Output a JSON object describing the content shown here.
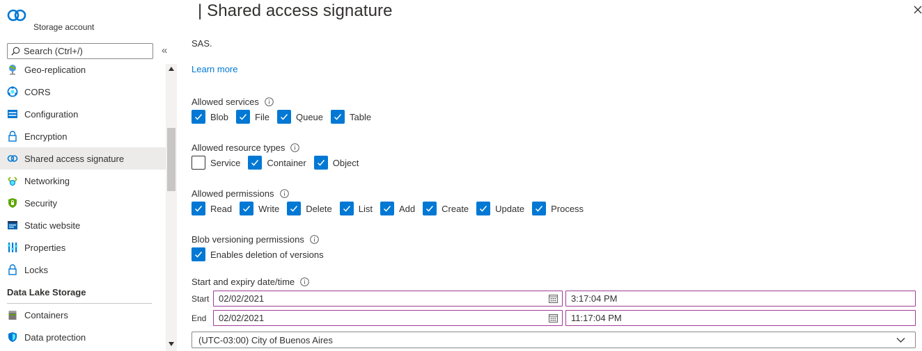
{
  "sidebar": {
    "subtitle": "Storage account",
    "search_placeholder": "Search (Ctrl+/)",
    "collapse_glyph": "«",
    "items": [
      {
        "label": "Geo-replication",
        "icon": "globe-icon"
      },
      {
        "label": "CORS",
        "icon": "cors-icon"
      },
      {
        "label": "Configuration",
        "icon": "configuration-icon"
      },
      {
        "label": "Encryption",
        "icon": "lock-icon"
      },
      {
        "label": "Shared access signature",
        "icon": "link-icon",
        "active": true
      },
      {
        "label": "Networking",
        "icon": "networking-icon"
      },
      {
        "label": "Security",
        "icon": "shield-icon"
      },
      {
        "label": "Static website",
        "icon": "static-website-icon"
      },
      {
        "label": "Properties",
        "icon": "properties-icon"
      },
      {
        "label": "Locks",
        "icon": "lock-icon"
      }
    ],
    "section_title": "Data Lake Storage",
    "section_items": [
      {
        "label": "Containers",
        "icon": "container-icon"
      },
      {
        "label": "Data protection",
        "icon": "data-protection-icon"
      }
    ]
  },
  "main": {
    "title": "| Shared access signature",
    "description": "SAS.",
    "learn_more": "Learn more",
    "allowed_services": {
      "label": "Allowed services",
      "options": [
        {
          "label": "Blob",
          "checked": true
        },
        {
          "label": "File",
          "checked": true
        },
        {
          "label": "Queue",
          "checked": true
        },
        {
          "label": "Table",
          "checked": true
        }
      ]
    },
    "allowed_resource_types": {
      "label": "Allowed resource types",
      "options": [
        {
          "label": "Service",
          "checked": false
        },
        {
          "label": "Container",
          "checked": true
        },
        {
          "label": "Object",
          "checked": true
        }
      ]
    },
    "allowed_permissions": {
      "label": "Allowed permissions",
      "options": [
        {
          "label": "Read",
          "checked": true
        },
        {
          "label": "Write",
          "checked": true
        },
        {
          "label": "Delete",
          "checked": true
        },
        {
          "label": "List",
          "checked": true
        },
        {
          "label": "Add",
          "checked": true
        },
        {
          "label": "Create",
          "checked": true
        },
        {
          "label": "Update",
          "checked": true
        },
        {
          "label": "Process",
          "checked": true
        }
      ]
    },
    "blob_versioning": {
      "label": "Blob versioning permissions",
      "options": [
        {
          "label": "Enables deletion of versions",
          "checked": true
        }
      ]
    },
    "datetime": {
      "label": "Start and expiry date/time",
      "start_label": "Start",
      "start_date": "02/02/2021",
      "start_time": "3:17:04 PM",
      "end_label": "End",
      "end_date": "02/02/2021",
      "end_time": "11:17:04 PM",
      "timezone": "(UTC-03:00) City of Buenos Aires"
    }
  },
  "colors": {
    "accent": "#0078d4",
    "field_border": "#a03a96",
    "active_nav": "#edebe9"
  }
}
